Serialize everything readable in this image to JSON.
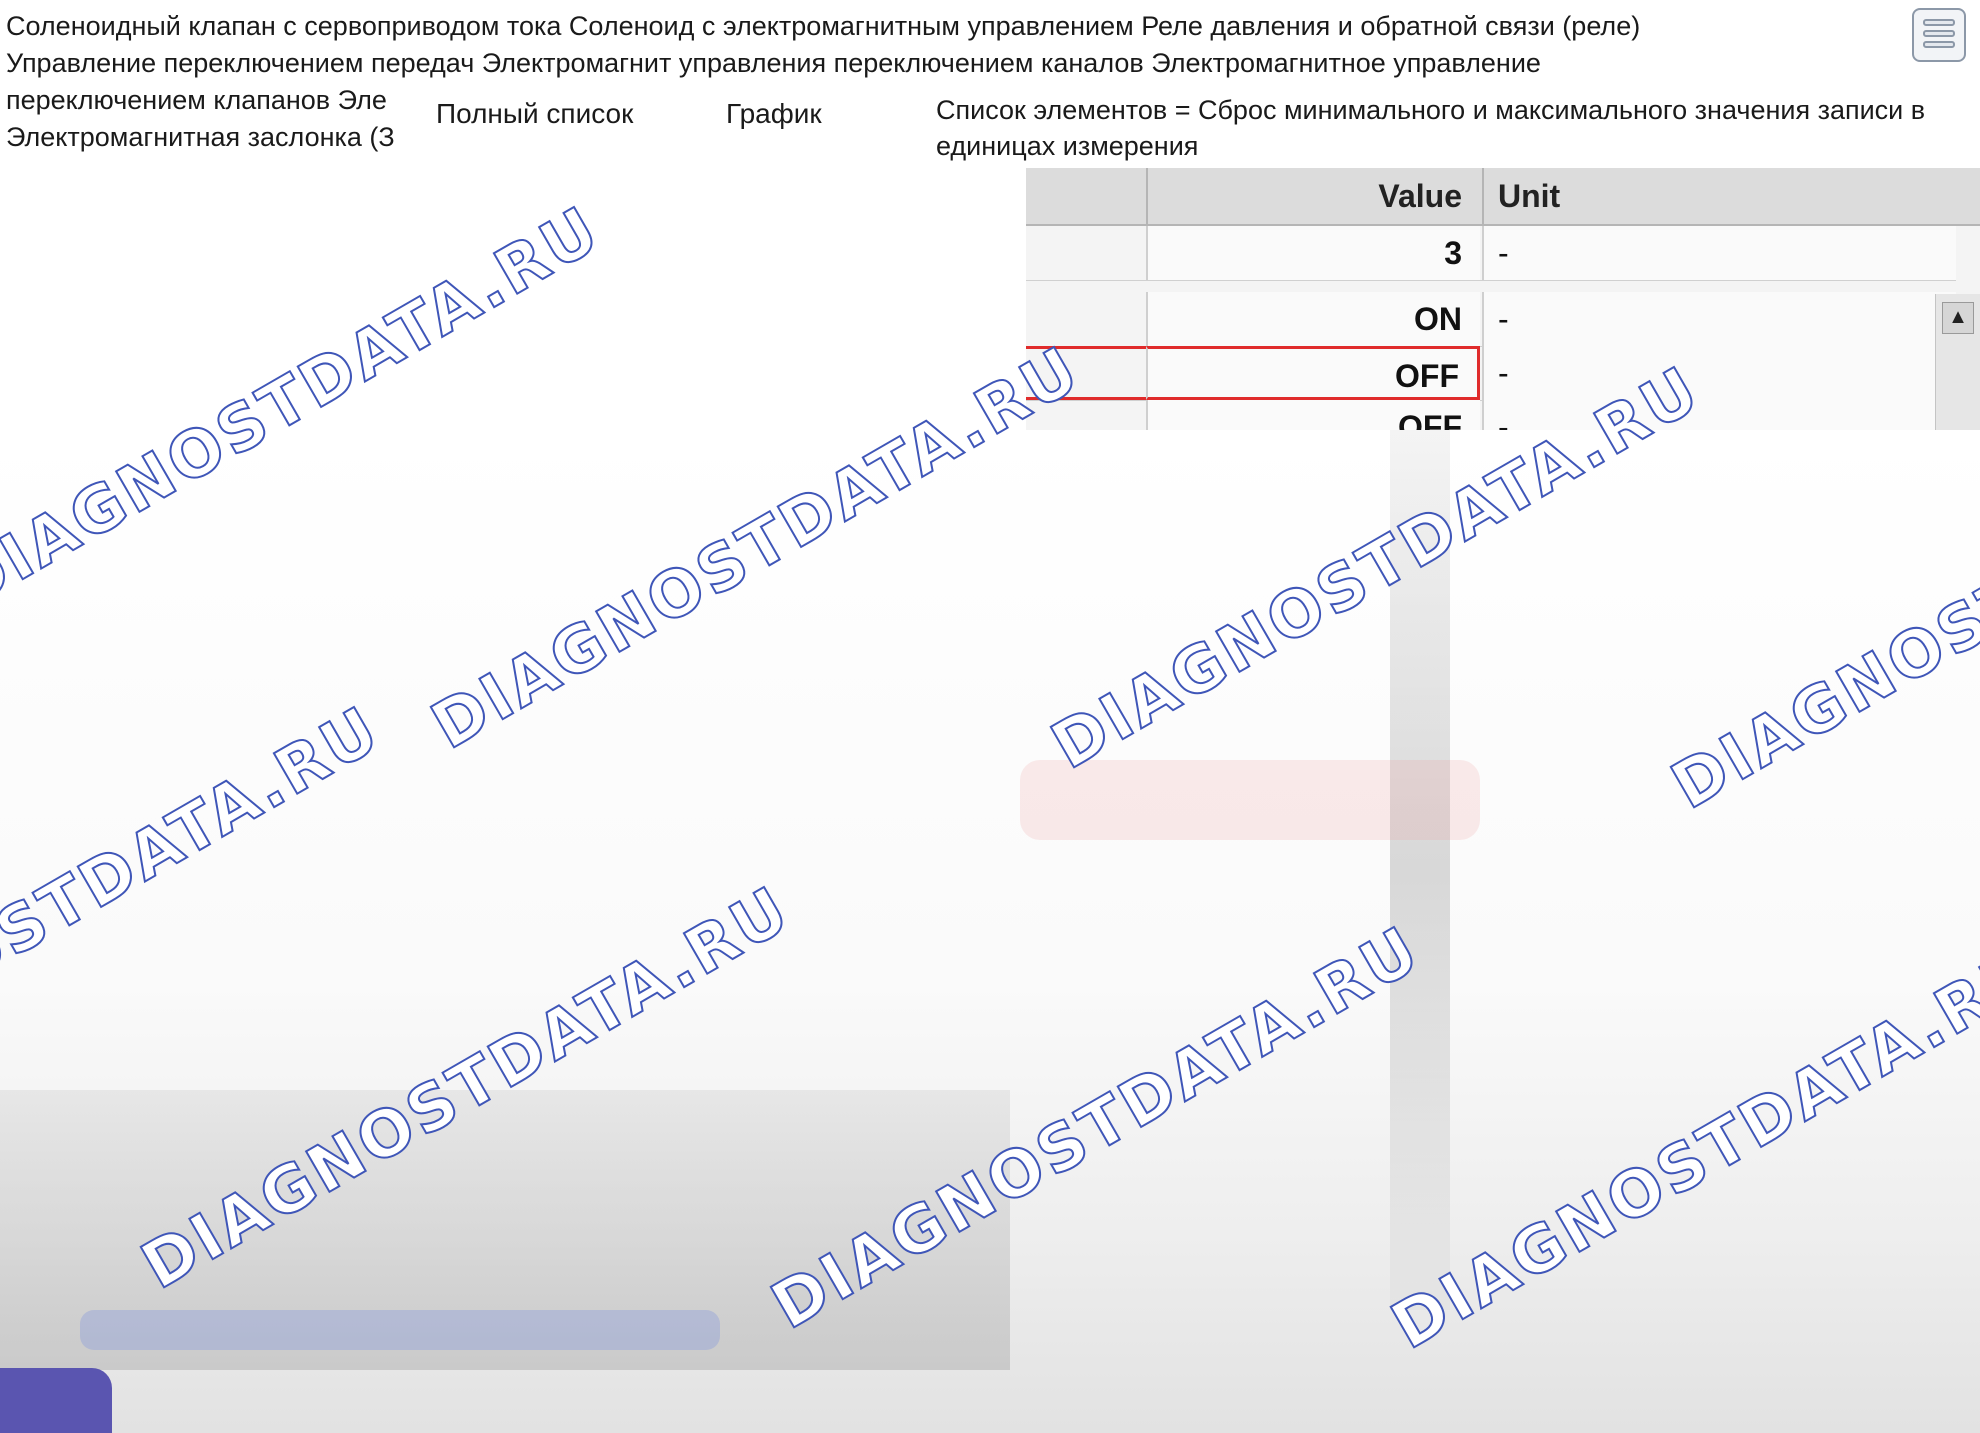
{
  "header": {
    "lines": [
      "Соленоидный клапан с сервоприводом тока Соленоид с электромагнитным управлением Реле давления и обратной связи (реле)",
      "Управление переключением передач Электромагнит управления переключением каналов Электромагнитное управление",
      "переключением клапанов Эле",
      "Электромагнитная заслонка (З"
    ]
  },
  "tabs": {
    "full_list": "Полный список",
    "graph": "График"
  },
  "info_box": {
    "text": "Список элементов = Сброс минимального и максимального значения записи в единицах измерения"
  },
  "table": {
    "columns": {
      "value": "Value",
      "unit": "Unit"
    },
    "rows": [
      {
        "value": "3",
        "unit": "-"
      },
      {
        "value": "ON",
        "unit": "-"
      },
      {
        "value": "OFF",
        "unit": "-"
      },
      {
        "value": "OFF",
        "unit": "-"
      }
    ]
  },
  "watermark": "DIAGNOSTDATA.RU",
  "colors": {
    "selection_border": "#e02b2b",
    "watermark_outline": "#3f56b8",
    "corner_swatch": "#5a55b0"
  }
}
